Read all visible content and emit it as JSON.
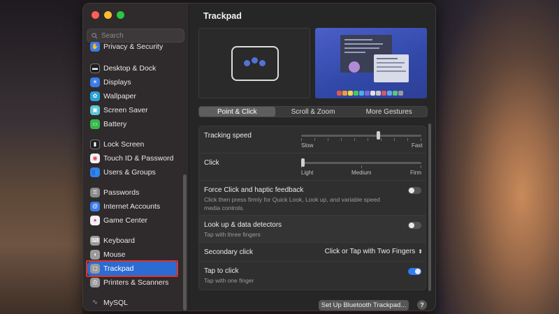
{
  "search": {
    "placeholder": "Search"
  },
  "sidebar": {
    "items": [
      {
        "label": "Privacy & Security"
      },
      {
        "label": "Desktop & Dock"
      },
      {
        "label": "Displays"
      },
      {
        "label": "Wallpaper"
      },
      {
        "label": "Screen Saver"
      },
      {
        "label": "Battery"
      },
      {
        "label": "Lock Screen"
      },
      {
        "label": "Touch ID & Password"
      },
      {
        "label": "Users & Groups"
      },
      {
        "label": "Passwords"
      },
      {
        "label": "Internet Accounts"
      },
      {
        "label": "Game Center"
      },
      {
        "label": "Keyboard"
      },
      {
        "label": "Mouse"
      },
      {
        "label": "Trackpad"
      },
      {
        "label": "Printers & Scanners"
      },
      {
        "label": "MySQL"
      }
    ],
    "selected": "Trackpad"
  },
  "main": {
    "title": "Trackpad",
    "tabs": [
      {
        "label": "Point & Click",
        "active": true
      },
      {
        "label": "Scroll & Zoom",
        "active": false
      },
      {
        "label": "More Gestures",
        "active": false
      }
    ],
    "tracking_speed": {
      "label": "Tracking speed",
      "min_label": "Slow",
      "max_label": "Fast",
      "value_fraction": 0.64
    },
    "click": {
      "label": "Click",
      "low_label": "Light",
      "mid_label": "Medium",
      "high_label": "Firm",
      "value_fraction": 0.0
    },
    "force_click": {
      "label": "Force Click and haptic feedback",
      "description": "Click then press firmly for Quick Look, Look up, and variable speed media controls.",
      "enabled": false
    },
    "look_up": {
      "label": "Look up & data detectors",
      "description": "Tap with three fingers",
      "enabled": false
    },
    "secondary_click": {
      "label": "Secondary click",
      "value": "Click or Tap with Two Fingers"
    },
    "tap_to_click": {
      "label": "Tap to click",
      "description": "Tap with one finger",
      "enabled": true
    },
    "bluetooth_button": "Set Up Bluetooth Trackpad...",
    "help_button": "?"
  },
  "colors": {
    "accent": "#2f7cf6",
    "selection": "#2c6bd2",
    "highlight_outline": "#e0322b"
  }
}
